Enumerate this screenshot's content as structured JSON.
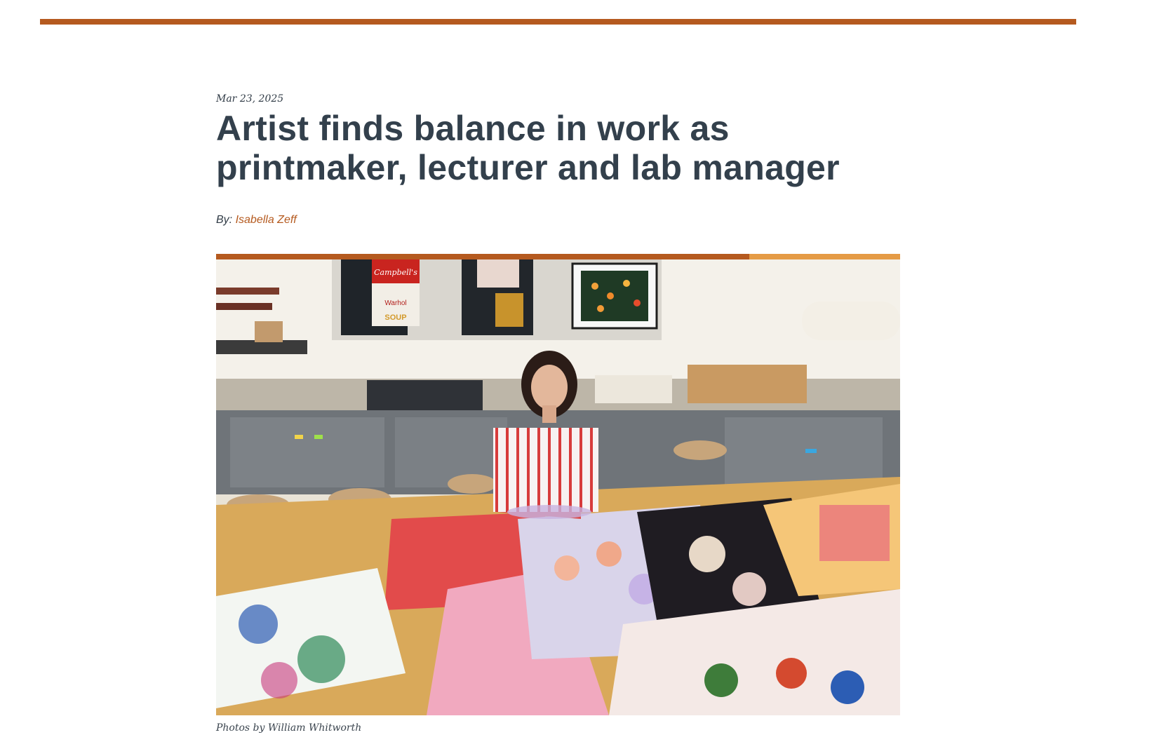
{
  "article": {
    "date": "Mar 23, 2025",
    "headline_line1": "Artist finds balance in work as",
    "headline_line2": "printmaker, lecturer and lab manager",
    "byline_prefix": "By:",
    "author": "Isabella Zeff"
  },
  "figure": {
    "photo_label": "photo-artist-in-print-studio",
    "caption": "Photos by William Whitworth",
    "poster_text_1": "Campbell's",
    "poster_text_2": "Warhol",
    "poster_text_3": "SOUP"
  },
  "colors": {
    "accent": "#b55a1f",
    "accent_light": "#e59b45",
    "heading": "#33404c"
  }
}
